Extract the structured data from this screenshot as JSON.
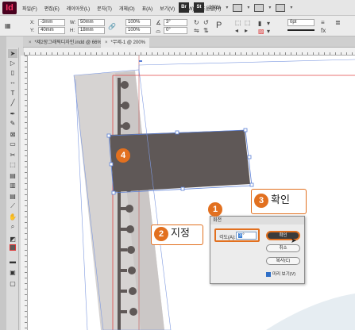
{
  "app": {
    "logo": "Id"
  },
  "menu": {
    "items": [
      "파일(F)",
      "편집(E)",
      "레이아웃(L)",
      "문자(T)",
      "개체(O)",
      "표(A)",
      "보기(V)",
      "창(W)",
      "도움말(H)"
    ],
    "right": {
      "br": "Br",
      "st": "St",
      "zoom": "200%"
    }
  },
  "control": {
    "x_label": "X:",
    "x_value": "-3mm",
    "y_label": "Y:",
    "y_value": "40mm",
    "w_label": "W:",
    "w_value": "50mm",
    "h_label": "H:",
    "h_value": "18mm",
    "scale_x": "100%",
    "scale_y": "100%",
    "rotate": "3°",
    "shear": "0°",
    "stroke_weight": "0pt"
  },
  "tabs": [
    {
      "label": "*제2장그래픽디자인.indd @ 66%",
      "active": false
    },
    {
      "label": "*무제-1 @ 200%",
      "active": true
    }
  ],
  "dialog": {
    "title": "회전",
    "angle_label": "각도(A):",
    "angle_value": "3",
    "angle_unit": "°",
    "ok_label": "확인",
    "cancel_label": "취소",
    "copy_label": "복사(C)",
    "preview_label": "미리 보기(V)",
    "preview_checked": true
  },
  "callouts": {
    "step1": "1",
    "step2_num": "2",
    "step2_text": "지정",
    "step3_num": "3",
    "step3_text": "확인",
    "step4": "4"
  },
  "colors": {
    "accent": "#e2701f",
    "film": "#5f5857",
    "strip": "#d6d3d2",
    "selection": "#5b7fd6",
    "guide": "#e04444"
  }
}
